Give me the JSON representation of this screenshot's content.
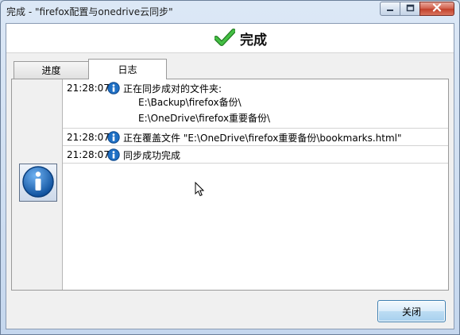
{
  "window": {
    "title": "完成 - \"firefox配置与onedrive云同步\"",
    "controls": {
      "minimize_icon": "minimize-icon",
      "maximize_icon": "maximize-icon",
      "close_icon": "close-icon"
    }
  },
  "header": {
    "icon": "checkmark-icon",
    "title": "完成"
  },
  "tabs": [
    {
      "label": "进度",
      "active": false
    },
    {
      "label": "日志",
      "active": true
    }
  ],
  "sidebar_icon": "info-icon",
  "log": [
    {
      "time": "21:28:07",
      "icon": "info-icon",
      "message": "正在同步成对的文件夹:",
      "details": [
        "E:\\Backup\\firefox备份\\",
        "E:\\OneDrive\\firefox重要备份\\"
      ]
    },
    {
      "time": "21:28:07",
      "icon": "info-icon",
      "message": "正在覆盖文件 \"E:\\OneDrive\\firefox重要备份\\bookmarks.html\"",
      "details": []
    },
    {
      "time": "21:28:07",
      "icon": "info-icon",
      "message": "同步成功完成",
      "details": []
    }
  ],
  "footer": {
    "close_label": "关闭"
  },
  "colors": {
    "info_blue": "#1e6fc4",
    "check_green": "#2fa12f",
    "accent_button": "#3c7fb1"
  }
}
